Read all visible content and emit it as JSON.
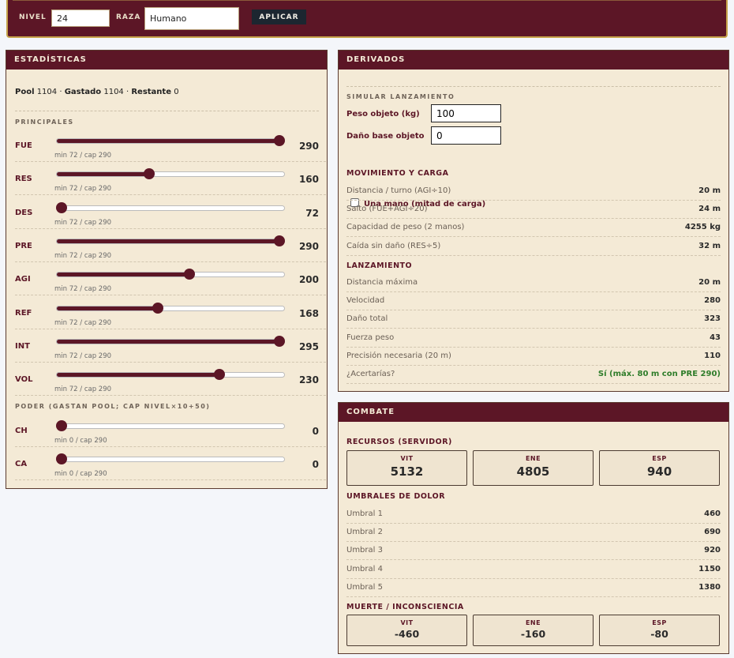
{
  "topbar": {
    "nivel_label": "NIVEL",
    "nivel_value": "24",
    "raza_label": "RAZA",
    "raza_value": "Humano",
    "apply_label": "APLICAR"
  },
  "stats": {
    "title": "ESTADÍSTICAS",
    "pool_label": "Pool",
    "pool_value": "1104",
    "spent_label": "Gastado",
    "spent_value": "1104",
    "remaining_label": "Restante",
    "remaining_value": "0",
    "principal_title": "PRINCIPALES",
    "principal": [
      {
        "code": "FUE",
        "value": 290,
        "min": 72,
        "cap": 290,
        "caption": "min 72 / cap 290",
        "display": "290"
      },
      {
        "code": "RES",
        "value": 160,
        "min": 72,
        "cap": 290,
        "caption": "min 72 / cap 290",
        "display": "160"
      },
      {
        "code": "DES",
        "value": 72,
        "min": 72,
        "cap": 290,
        "caption": "min 72 / cap 290",
        "display": "72"
      },
      {
        "code": "PRE",
        "value": 290,
        "min": 72,
        "cap": 290,
        "caption": "min 72 / cap 290",
        "display": "290"
      },
      {
        "code": "AGI",
        "value": 200,
        "min": 72,
        "cap": 290,
        "caption": "min 72 / cap 290",
        "display": "200"
      },
      {
        "code": "REF",
        "value": 168,
        "min": 72,
        "cap": 290,
        "caption": "min 72 / cap 290",
        "display": "168"
      },
      {
        "code": "INT",
        "value": 295,
        "min": 72,
        "cap": 290,
        "caption": "min 72 / cap 290",
        "display": "295"
      },
      {
        "code": "VOL",
        "value": 230,
        "min": 72,
        "cap": 290,
        "caption": "min 72 / cap 290",
        "display": "230"
      }
    ],
    "power_title": "PODER (GASTAN POOL; CAP NIVEL×10+50)",
    "power": [
      {
        "code": "CH",
        "value": 0,
        "min": 0,
        "cap": 290,
        "caption": "min 0 / cap 290",
        "display": "0"
      },
      {
        "code": "CA",
        "value": 0,
        "min": 0,
        "cap": 290,
        "caption": "min 0 / cap 290",
        "display": "0"
      }
    ]
  },
  "derived": {
    "title": "DERIVADOS",
    "sim_title": "SIMULAR LANZAMIENTO",
    "peso_label": "Peso objeto (kg)",
    "peso_value": "100",
    "dano_label": "Daño base objeto",
    "dano_value": "0",
    "one_hand_label": "Una mano (mitad de carga)",
    "movement_title": "MOVIMIENTO Y CARGA",
    "movement": [
      {
        "k": "Distancia / turno (AGI÷10)",
        "v": "20 m"
      },
      {
        "k": "Salto (FUE+AGI÷20)",
        "v": "24 m"
      },
      {
        "k": "Capacidad de peso (2 manos)",
        "v": "4255 kg"
      },
      {
        "k": "Caída sin daño (RES÷5)",
        "v": "32 m"
      }
    ],
    "throw_title": "LANZAMIENTO",
    "throw": [
      {
        "k": "Distancia máxima",
        "v": "20 m"
      },
      {
        "k": "Velocidad",
        "v": "280"
      },
      {
        "k": "Daño total",
        "v": "323"
      },
      {
        "k": "Fuerza peso",
        "v": "43"
      },
      {
        "k": "Precisión necesaria (20 m)",
        "v": "110"
      },
      {
        "k": "¿Acertarías?",
        "v": "Sí (máx. 80 m con PRE 290)"
      }
    ]
  },
  "combat": {
    "title": "COMBATE",
    "resources_title": "RECURSOS (SERVIDOR)",
    "resources": [
      {
        "label": "VIT",
        "value": "5132"
      },
      {
        "label": "ENE",
        "value": "4805"
      },
      {
        "label": "ESP",
        "value": "940"
      }
    ],
    "pain_title": "UMBRALES DE DOLOR",
    "pain": [
      {
        "k": "Umbral 1",
        "v": "460"
      },
      {
        "k": "Umbral 2",
        "v": "690"
      },
      {
        "k": "Umbral 3",
        "v": "920"
      },
      {
        "k": "Umbral 4",
        "v": "1150"
      },
      {
        "k": "Umbral 5",
        "v": "1380"
      }
    ],
    "death_title": "MUERTE / INCONSCIENCIA",
    "death": [
      {
        "label": "VIT",
        "value": "-460"
      },
      {
        "label": "ENE",
        "value": "-160"
      },
      {
        "label": "ESP",
        "value": "-80"
      }
    ]
  },
  "colors": {
    "accent": "#5c1626",
    "panel_bg": "#f4ead6",
    "success": "#2f7d2a"
  }
}
